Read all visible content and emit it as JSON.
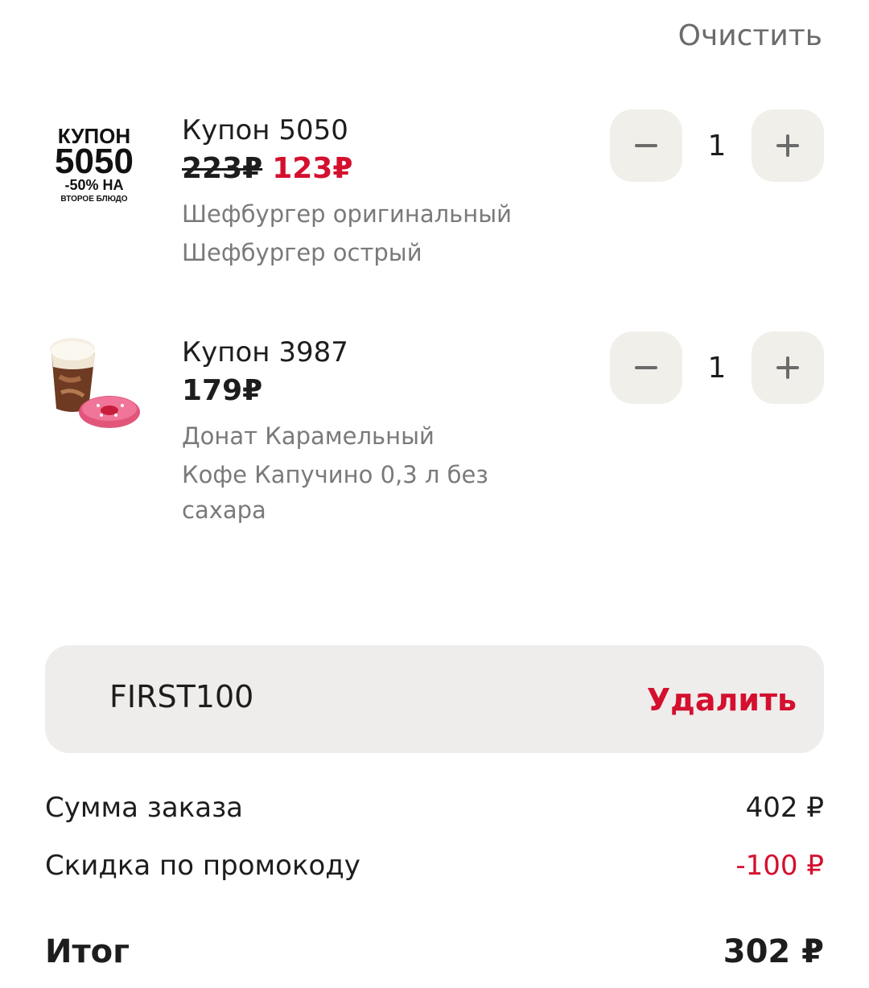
{
  "header": {
    "clear_label": "Очистить"
  },
  "items": [
    {
      "title": "Купон 5050",
      "price_old": "223₽",
      "price_new": "123₽",
      "desc": [
        "Шефбургер оригинальный",
        "Шефбургер острый"
      ],
      "qty": "1",
      "image_text": {
        "line1": "КУПОН",
        "line2": "5050",
        "line3": "-50% НА",
        "line4": "ВТОРОЕ БЛЮДО"
      }
    },
    {
      "title": "Купон 3987",
      "price": "179₽",
      "desc": [
        "Донат Карамельный",
        "Кофе Капучино 0,3 л без",
        "сахара"
      ],
      "qty": "1"
    }
  ],
  "promo": {
    "code": "FIRST100",
    "remove_label": "Удалить"
  },
  "summary": {
    "subtotal_label": "Сумма заказа",
    "subtotal_value": "402 ₽",
    "discount_label": "Скидка по промокоду",
    "discount_value": "-100 ₽",
    "total_label": "Итог",
    "total_value": "302 ₽"
  },
  "colors": {
    "accent": "#d4102f",
    "button_bg": "#f1efea",
    "promo_bg": "#efedec"
  },
  "icons": [
    "minus-icon",
    "plus-icon"
  ]
}
